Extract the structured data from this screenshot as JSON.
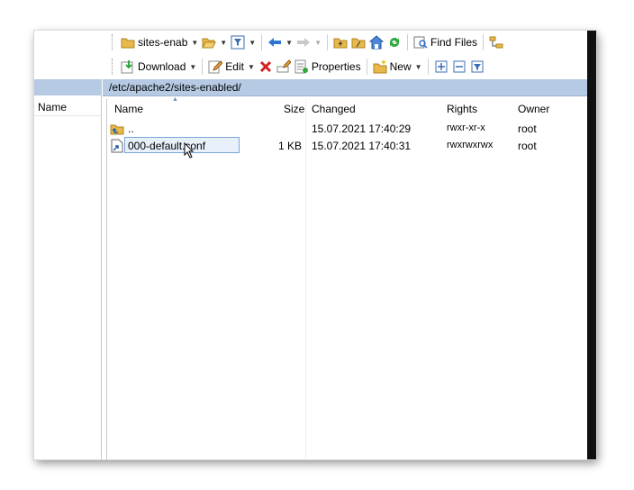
{
  "toolbar1": {
    "site_dropdown": "sites-enab",
    "find_files": "Find Files"
  },
  "toolbar2": {
    "download": "Download",
    "edit": "Edit",
    "properties": "Properties",
    "new": "New"
  },
  "path": "/etc/apache2/sites-enabled/",
  "left_pane": {
    "col_name": "Name"
  },
  "columns": {
    "name": "Name",
    "size": "Size",
    "changed": "Changed",
    "rights": "Rights",
    "owner": "Owner"
  },
  "files": [
    {
      "name": "..",
      "size": "",
      "changed": "15.07.2021 17:40:29",
      "rights": "rwxr-xr-x",
      "owner": "root"
    },
    {
      "name": "000-default.conf",
      "size": "1 KB",
      "changed": "15.07.2021 17:40:31",
      "rights": "rwxrwxrwx",
      "owner": "root"
    }
  ],
  "colors": {
    "pathbar": "#b6cbe3",
    "selection_border": "#7aa7d8"
  }
}
